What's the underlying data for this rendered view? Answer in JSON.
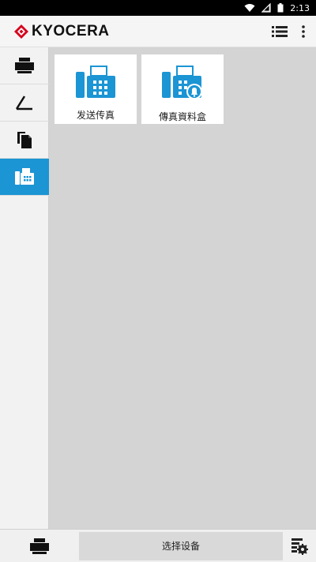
{
  "status_bar": {
    "time": "2:13",
    "icons": [
      "wifi-icon",
      "signal-icon",
      "battery-icon"
    ]
  },
  "app_bar": {
    "logo_text": "KYOCERA",
    "actions": [
      "list-view-icon",
      "more-vert-icon"
    ]
  },
  "sidebar": {
    "items": [
      {
        "icon": "printer-icon",
        "active": false
      },
      {
        "icon": "scanner-icon",
        "active": false
      },
      {
        "icon": "copy-icon",
        "active": false
      },
      {
        "icon": "fax-icon",
        "active": true
      }
    ]
  },
  "tiles": [
    {
      "label": "发送传真",
      "icon": "fax-send-icon"
    },
    {
      "label": "傳真資料盒",
      "icon": "fax-box-icon"
    }
  ],
  "bottom_bar": {
    "select_device_label": "选择设备",
    "left_icon": "printer-icon",
    "right_icon": "device-settings-icon"
  },
  "colors": {
    "accent": "#1b95d4",
    "logo_red": "#d6001c"
  }
}
